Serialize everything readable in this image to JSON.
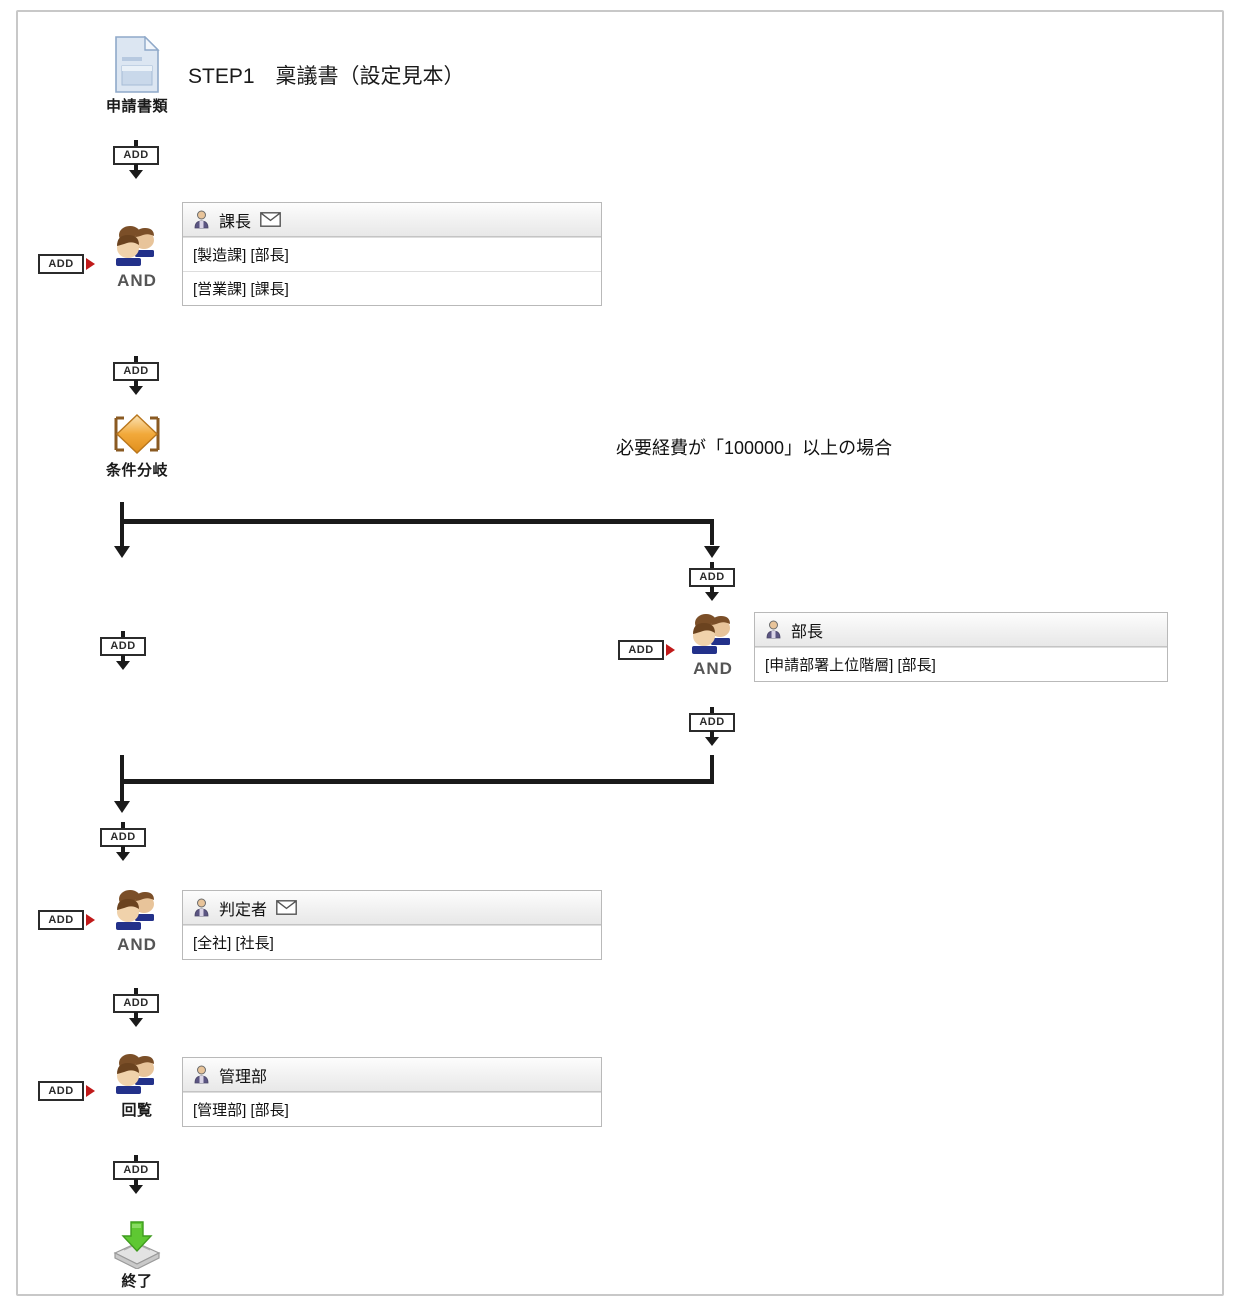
{
  "diagram": {
    "title": "STEP1　稟議書（設定見本）",
    "frame_border_color": "#c8c8c8",
    "line_color": "#1a1a1a",
    "add_label": "ADD"
  },
  "start_node": {
    "icon": "document-icon",
    "caption": "申請書類"
  },
  "branch_node": {
    "icon": "diamond-icon",
    "caption": "条件分岐",
    "condition_label": "必要経費が「100000」以上の場合"
  },
  "end_node": {
    "icon": "end-arrow-tray-icon",
    "caption": "終了"
  },
  "steps": [
    {
      "id": "kacho",
      "icon": "people-icon",
      "caption": "AND",
      "title": "課長",
      "has_mail_icon": true,
      "rows": [
        "[製造課] [部長]",
        "[営業課] [課長]"
      ]
    },
    {
      "id": "bucho",
      "icon": "people-icon",
      "caption": "AND",
      "title": "部長",
      "has_mail_icon": false,
      "rows": [
        "[申請部署上位階層] [部長]"
      ]
    },
    {
      "id": "hanteisha",
      "icon": "people-icon",
      "caption": "AND",
      "title": "判定者",
      "has_mail_icon": true,
      "rows": [
        "[全社] [社長]"
      ]
    },
    {
      "id": "kanribu",
      "icon": "people-icon",
      "caption": "回覧",
      "title": "管理部",
      "has_mail_icon": false,
      "rows": [
        "[管理部] [部長]"
      ]
    }
  ],
  "add_buttons": {
    "after_start": "ADD",
    "left_of_kacho": "ADD",
    "after_kacho": "ADD",
    "left_branch": "ADD",
    "right_branch_top": "ADD",
    "left_of_bucho": "ADD",
    "right_branch_bottom": "ADD",
    "after_merge": "ADD",
    "left_of_hanteisha": "ADD",
    "after_hanteisha": "ADD",
    "left_of_kanribu": "ADD",
    "after_kanribu": "ADD"
  }
}
